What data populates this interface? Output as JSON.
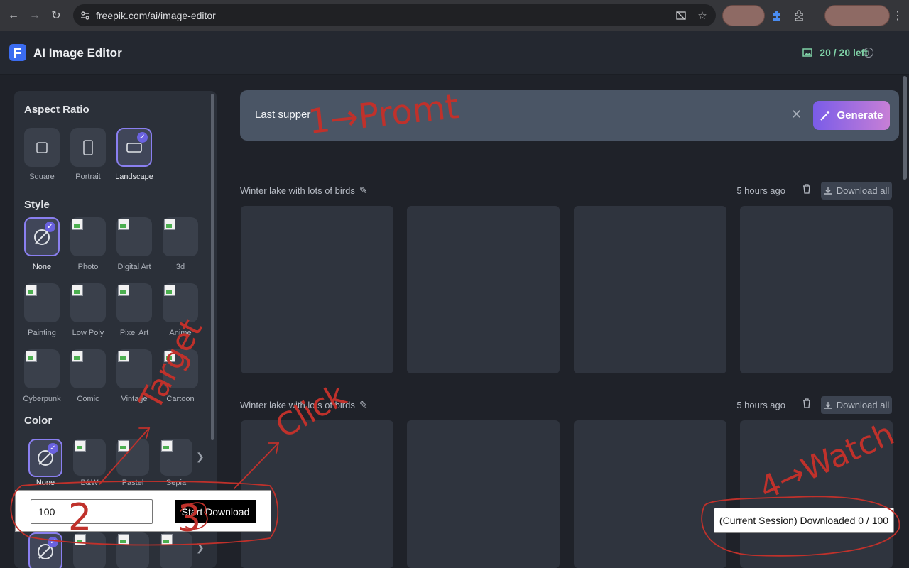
{
  "browser": {
    "url": "freepik.com/ai/image-editor"
  },
  "header": {
    "title": "AI Image Editor",
    "credits": "20 / 20 left"
  },
  "sidebar": {
    "aspect_title": "Aspect Ratio",
    "aspect": [
      {
        "label": "Square",
        "icon": "square-icon"
      },
      {
        "label": "Portrait",
        "icon": "portrait-icon"
      },
      {
        "label": "Landscape",
        "icon": "landscape-icon",
        "selected": true
      }
    ],
    "style_title": "Style",
    "styles": [
      {
        "label": "None",
        "selected": true
      },
      {
        "label": "Photo"
      },
      {
        "label": "Digital Art"
      },
      {
        "label": "3d"
      },
      {
        "label": "Painting"
      },
      {
        "label": "Low Poly"
      },
      {
        "label": "Pixel Art"
      },
      {
        "label": "Anime"
      },
      {
        "label": "Cyberpunk"
      },
      {
        "label": "Comic"
      },
      {
        "label": "Vintage"
      },
      {
        "label": "Cartoon"
      }
    ],
    "color_title": "Color",
    "colors": [
      {
        "label": "None",
        "selected": true
      },
      {
        "label": "B&W"
      },
      {
        "label": "Pastel"
      },
      {
        "label": "Sepia"
      }
    ]
  },
  "prompt": {
    "value": "Last supper",
    "generate_label": "Generate"
  },
  "groups": [
    {
      "title": "Winter lake with lots of birds",
      "time": "5 hours ago",
      "download_label": "Download all"
    },
    {
      "title": "Winter lake with lots of birds",
      "time": "5 hours ago",
      "download_label": "Download all"
    }
  ],
  "extension": {
    "count_value": "100",
    "start_label": "Start Download",
    "status": "(Current Session) Downloaded 0 / 100"
  },
  "annotations": {
    "a1": "1→Promt",
    "a2": "2",
    "a3": "3",
    "a_target": "Target",
    "a_click": "Click",
    "a4": "4→Watch"
  },
  "colors": {
    "accent": "#7a5ce8",
    "credits": "#7fd1a6",
    "annotation": "#c0312b"
  }
}
